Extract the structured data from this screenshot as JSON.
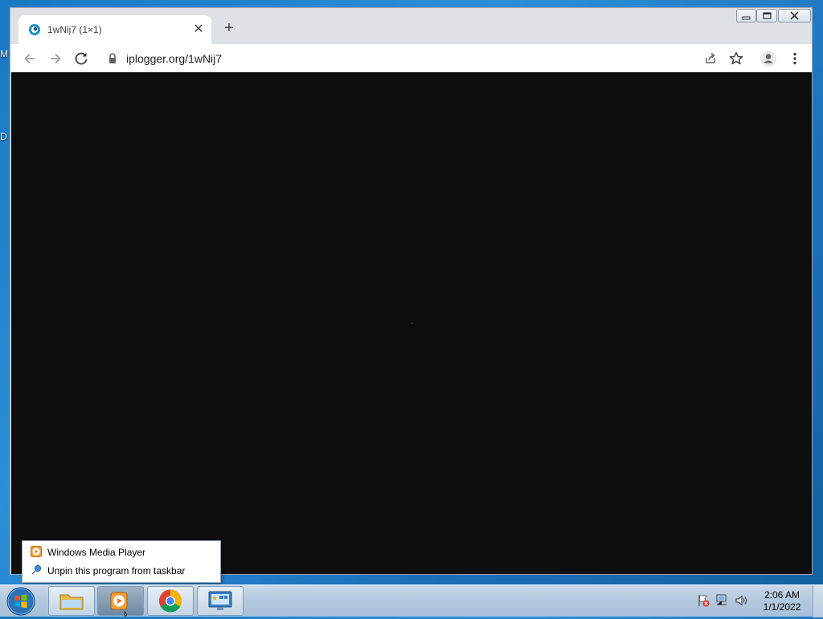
{
  "desktop": {
    "side_labels": [
      "M",
      "D"
    ]
  },
  "browser": {
    "tab_title": "1wNij7 (1×1)",
    "tab_close_glyph": "✕",
    "new_tab_glyph": "+",
    "url": "iplogger.org/1wNij7",
    "content_background": "#0e0e0e",
    "icons": [
      "back-icon",
      "forward-icon",
      "reload-icon",
      "lock-icon",
      "share-icon",
      "bookmark-star-icon",
      "profile-icon",
      "menu-icon"
    ]
  },
  "jump_list": {
    "items": [
      {
        "label": "Windows Media Player",
        "icon": "media-player-icon"
      },
      {
        "label": "Unpin this program from taskbar",
        "icon": "unpin-icon"
      }
    ]
  },
  "taskbar": {
    "buttons": [
      "file-explorer",
      "windows-media-player",
      "google-chrome",
      "control-panel"
    ],
    "clock": {
      "time": "2:06 AM",
      "date": "1/1/2022"
    },
    "tray_icons": [
      "action-center-flag-icon",
      "network-icon",
      "volume-icon"
    ]
  },
  "colors": {
    "accent": "#1a73e8",
    "taskbar": "#b2c8de"
  }
}
